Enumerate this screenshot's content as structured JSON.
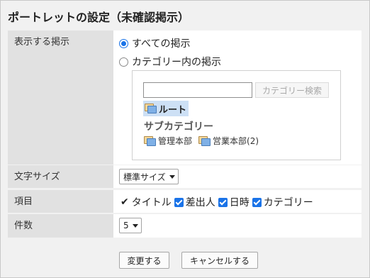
{
  "page": {
    "title": "ポートレットの設定（未確認掲示）"
  },
  "display_section": {
    "label": "表示する掲示",
    "options": [
      {
        "label": "すべての掲示",
        "selected": true
      },
      {
        "label": "カテゴリー内の掲示",
        "selected": false
      }
    ],
    "category_picker": {
      "search_value": "",
      "search_button": "カテゴリー検索",
      "root": "ルート",
      "subcategory_label": "サブカテゴリー",
      "subcategories": [
        "管理本部",
        "営業本部(2)"
      ]
    }
  },
  "font_size": {
    "label": "文字サイズ",
    "selected": "標準サイズ"
  },
  "items": {
    "label": "項目",
    "fixed": {
      "label": "タイトル",
      "checked": true
    },
    "options": [
      {
        "label": "差出人",
        "checked": true
      },
      {
        "label": "日時",
        "checked": true
      },
      {
        "label": "カテゴリー",
        "checked": true
      }
    ]
  },
  "count": {
    "label": "件数",
    "selected": "5"
  },
  "actions": {
    "save": "変更する",
    "cancel": "キャンセルする"
  },
  "colors": {
    "accent": "#1a73e8",
    "label_bg": "#e1e1e1",
    "frame_bg": "#f1f1f1",
    "selection": "#cde0f5"
  }
}
